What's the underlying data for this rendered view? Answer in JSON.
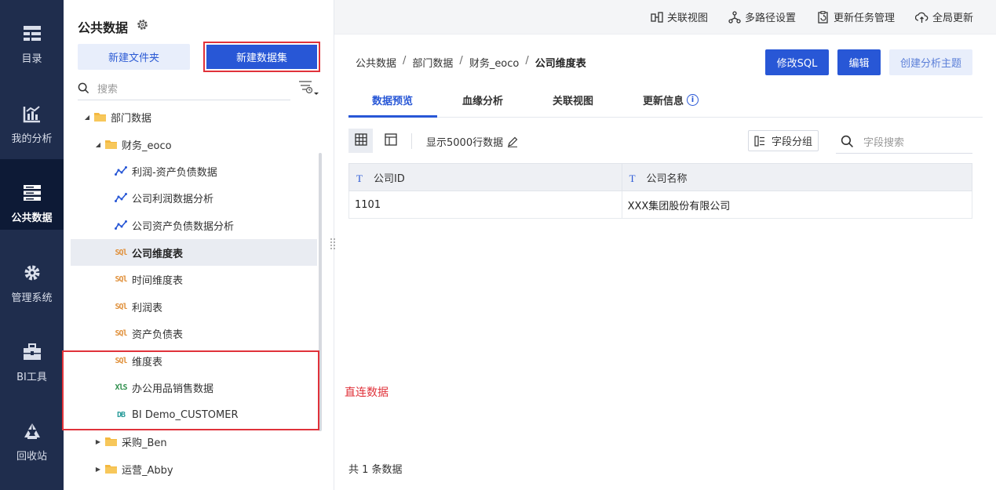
{
  "nav": {
    "items": [
      {
        "label": "目录",
        "icon": "catalog-icon"
      },
      {
        "label": "我的分析",
        "icon": "analysis-chart-icon"
      },
      {
        "label": "公共数据",
        "icon": "public-data-icon"
      },
      {
        "label": "管理系统",
        "icon": "gear-icon"
      },
      {
        "label": "BI工具",
        "icon": "toolbox-icon"
      },
      {
        "label": "回收站",
        "icon": "recycle-icon"
      }
    ],
    "active": "公共数据"
  },
  "tree_panel": {
    "title": "公共数据",
    "new_folder_label": "新建文件夹",
    "new_dataset_label": "新建数据集",
    "search_placeholder": "搜索",
    "items": [
      {
        "label": "部门数据",
        "type": "folder",
        "expanded": true
      },
      {
        "label": "财务_eoco",
        "type": "folder",
        "expanded": true
      },
      {
        "label": "利润-资产负债数据",
        "type": "analysis"
      },
      {
        "label": "公司利润数据分析",
        "type": "analysis"
      },
      {
        "label": "公司资产负债数据分析",
        "type": "analysis"
      },
      {
        "label": "公司维度表",
        "type": "sql",
        "selected": true
      },
      {
        "label": "时间维度表",
        "type": "sql"
      },
      {
        "label": "利润表",
        "type": "sql"
      },
      {
        "label": "资产负债表",
        "type": "sql"
      },
      {
        "label": "维度表",
        "type": "sql"
      },
      {
        "label": "办公用品销售数据",
        "type": "xls"
      },
      {
        "label": "BI Demo_CUSTOMER",
        "type": "db"
      },
      {
        "label": "采购_Ben",
        "type": "folder",
        "expanded": false
      },
      {
        "label": "运营_Abby",
        "type": "folder",
        "expanded": false
      }
    ],
    "icon_text": {
      "sql": "SQl",
      "xls": "XlS",
      "db": "DB"
    }
  },
  "annotation": {
    "direct_connect_label": "直连数据"
  },
  "topbar": {
    "actions": [
      {
        "label": "关联视图",
        "icon": "relation-view-icon"
      },
      {
        "label": "多路径设置",
        "icon": "multipath-icon"
      },
      {
        "label": "更新任务管理",
        "icon": "task-manage-icon"
      },
      {
        "label": "全局更新",
        "icon": "cloud-update-icon"
      }
    ]
  },
  "breadcrumb": [
    "公共数据",
    "部门数据",
    "财务_eoco",
    "公司维度表"
  ],
  "breadcrumb_sep": "/",
  "header_buttons": {
    "modify_sql": "修改SQL",
    "edit": "编辑",
    "create_topic": "创建分析主题"
  },
  "tabs": [
    {
      "label": "数据预览",
      "active": true
    },
    {
      "label": "血缘分析"
    },
    {
      "label": "关联视图"
    },
    {
      "label": "更新信息",
      "has_info": true
    }
  ],
  "info_glyph": "i",
  "toolbar": {
    "rows_label": "显示5000行数据",
    "field_group_label": "字段分组",
    "field_search_placeholder": "字段搜索"
  },
  "table": {
    "type_glyph": "T",
    "columns": [
      "公司ID",
      "公司名称"
    ],
    "rows": [
      [
        "1101",
        "XXX集团股份有限公司"
      ]
    ]
  },
  "footer": {
    "count_text": "共 1 条数据"
  }
}
